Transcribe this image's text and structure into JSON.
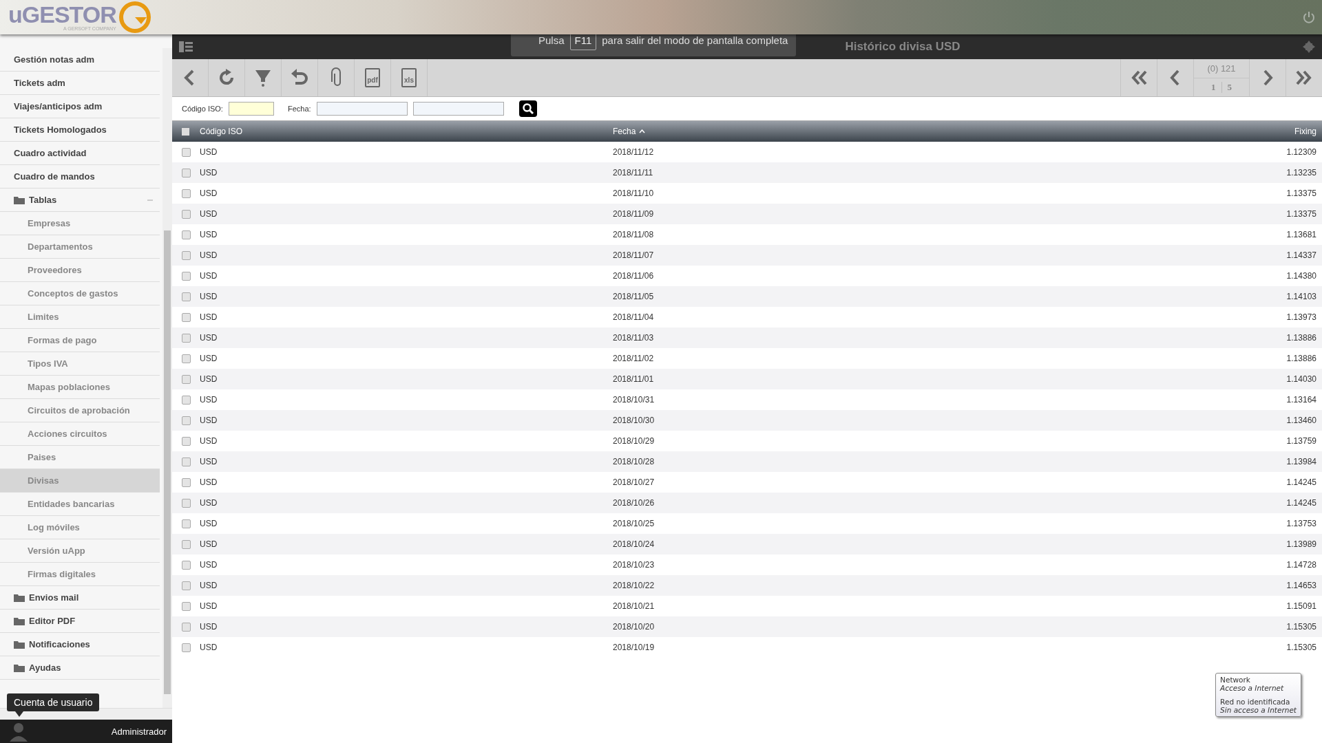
{
  "header": {
    "logo": "uGESTOR",
    "logo_tagline": "A GERSOFT COMPANY"
  },
  "title_bar": {
    "title": "Histórico divisa USD"
  },
  "fullscreen_notice": {
    "before": "Pulsa",
    "key": "F11",
    "after": "para salir del modo de pantalla completa"
  },
  "sidebar": {
    "items": [
      {
        "kind": "link",
        "label": "Gestión notas adm",
        "selected": false
      },
      {
        "kind": "link",
        "label": "Tickets adm",
        "selected": false
      },
      {
        "kind": "link",
        "label": "Viajes/anticipos adm",
        "selected": false
      },
      {
        "kind": "link",
        "label": "Tickets Homologados",
        "selected": false
      },
      {
        "kind": "link",
        "label": "Cuadro actividad",
        "selected": false
      },
      {
        "kind": "link",
        "label": "Cuadro de mandos",
        "selected": false
      },
      {
        "kind": "folder",
        "label": "Tablas",
        "expanded": true,
        "children": [
          {
            "label": "Empresas",
            "selected": false
          },
          {
            "label": "Departamentos",
            "selected": false
          },
          {
            "label": "Proveedores",
            "selected": false
          },
          {
            "label": "Conceptos de gastos",
            "selected": false
          },
          {
            "label": "Limites",
            "selected": false
          },
          {
            "label": "Formas de pago",
            "selected": false
          },
          {
            "label": "Tipos IVA",
            "selected": false
          },
          {
            "label": "Mapas poblaciones",
            "selected": false
          },
          {
            "label": "Circuitos de aprobación",
            "selected": false
          },
          {
            "label": "Acciones circuitos",
            "selected": false
          },
          {
            "label": "Paises",
            "selected": false
          },
          {
            "label": "Divisas",
            "selected": true
          },
          {
            "label": "Entidades bancarias",
            "selected": false
          },
          {
            "label": "Log móviles",
            "selected": false
          },
          {
            "label": "Versión uApp",
            "selected": false
          },
          {
            "label": "Firmas digitales",
            "selected": false
          }
        ]
      },
      {
        "kind": "folder",
        "label": "Envios mail",
        "expanded": false
      },
      {
        "kind": "folder",
        "label": "Editor PDF",
        "expanded": false
      },
      {
        "kind": "folder",
        "label": "Notificaciones",
        "expanded": false
      },
      {
        "kind": "folder",
        "label": "Ayudas",
        "expanded": false
      }
    ],
    "tooltip": "Cuenta de usuario",
    "user": "Administrador"
  },
  "toolbar": {
    "buttons": [
      {
        "kind": "back"
      },
      {
        "kind": "refresh"
      },
      {
        "kind": "filter"
      },
      {
        "kind": "undo"
      },
      {
        "kind": "attach"
      },
      {
        "kind": "pdf",
        "label": "pdf"
      },
      {
        "kind": "xls",
        "label": "xls"
      }
    ],
    "pager": {
      "count": "(0) 121",
      "page": "1",
      "pages": "5"
    }
  },
  "filters": {
    "code_label": "Código ISO:",
    "date_label": "Fecha:"
  },
  "table": {
    "all_checked": false,
    "columns": [
      {
        "label": "Código ISO",
        "sorted": false
      },
      {
        "label": "Fecha",
        "sorted": true
      },
      {
        "label": "Fixing",
        "sorted": false
      }
    ],
    "rows": [
      {
        "checked": false,
        "cells": [
          "USD",
          "2018/11/12",
          "1.12309"
        ]
      },
      {
        "checked": false,
        "cells": [
          "USD",
          "2018/11/11",
          "1.13235"
        ]
      },
      {
        "checked": false,
        "cells": [
          "USD",
          "2018/11/10",
          "1.13375"
        ]
      },
      {
        "checked": false,
        "cells": [
          "USD",
          "2018/11/09",
          "1.13375"
        ]
      },
      {
        "checked": false,
        "cells": [
          "USD",
          "2018/11/08",
          "1.13681"
        ]
      },
      {
        "checked": false,
        "cells": [
          "USD",
          "2018/11/07",
          "1.14337"
        ]
      },
      {
        "checked": false,
        "cells": [
          "USD",
          "2018/11/06",
          "1.14380"
        ]
      },
      {
        "checked": false,
        "cells": [
          "USD",
          "2018/11/05",
          "1.14103"
        ]
      },
      {
        "checked": false,
        "cells": [
          "USD",
          "2018/11/04",
          "1.13973"
        ]
      },
      {
        "checked": false,
        "cells": [
          "USD",
          "2018/11/03",
          "1.13886"
        ]
      },
      {
        "checked": false,
        "cells": [
          "USD",
          "2018/11/02",
          "1.13886"
        ]
      },
      {
        "checked": false,
        "cells": [
          "USD",
          "2018/11/01",
          "1.14030"
        ]
      },
      {
        "checked": false,
        "cells": [
          "USD",
          "2018/10/31",
          "1.13164"
        ]
      },
      {
        "checked": false,
        "cells": [
          "USD",
          "2018/10/30",
          "1.13460"
        ]
      },
      {
        "checked": false,
        "cells": [
          "USD",
          "2018/10/29",
          "1.13759"
        ]
      },
      {
        "checked": false,
        "cells": [
          "USD",
          "2018/10/28",
          "1.13984"
        ]
      },
      {
        "checked": false,
        "cells": [
          "USD",
          "2018/10/27",
          "1.14245"
        ]
      },
      {
        "checked": false,
        "cells": [
          "USD",
          "2018/10/26",
          "1.14245"
        ]
      },
      {
        "checked": false,
        "cells": [
          "USD",
          "2018/10/25",
          "1.13753"
        ]
      },
      {
        "checked": false,
        "cells": [
          "USD",
          "2018/10/24",
          "1.13989"
        ]
      },
      {
        "checked": false,
        "cells": [
          "USD",
          "2018/10/23",
          "1.14728"
        ]
      },
      {
        "checked": false,
        "cells": [
          "USD",
          "2018/10/22",
          "1.14653"
        ]
      },
      {
        "checked": false,
        "cells": [
          "USD",
          "2018/10/21",
          "1.15091"
        ]
      },
      {
        "checked": false,
        "cells": [
          "USD",
          "2018/10/20",
          "1.15305"
        ]
      },
      {
        "checked": false,
        "cells": [
          "USD",
          "2018/10/19",
          "1.15305"
        ]
      }
    ]
  },
  "network_tooltip": {
    "lines": [
      {
        "text": "Network",
        "italic": false
      },
      {
        "text": "Acceso a Internet",
        "italic": true
      },
      {
        "text": "Red no identificada",
        "italic": false
      },
      {
        "text": "Sin acceso a Internet",
        "italic": true
      }
    ]
  }
}
